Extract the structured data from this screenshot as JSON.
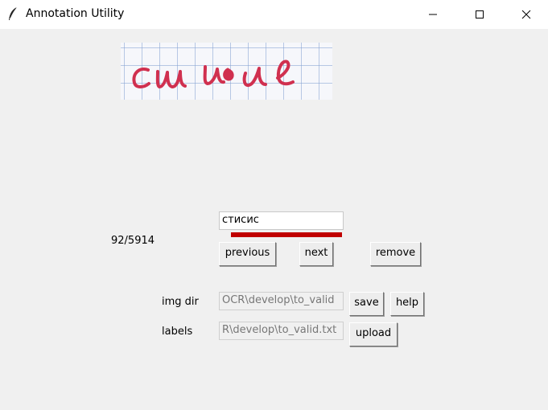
{
  "window": {
    "title": "Annotation Utility",
    "icon": "feather-icon",
    "controls": [
      "minimize-icon",
      "maximize-icon",
      "close-icon"
    ]
  },
  "preview": {
    "handwriting": "сиисис"
  },
  "annotation": {
    "counter": "92/5914",
    "text_value": "стисис",
    "progress_fraction": 1.0,
    "progress_color": "#c00000"
  },
  "buttons": {
    "previous": "previous",
    "next": "next",
    "remove": "remove",
    "save": "save",
    "help": "help",
    "upload": "upload"
  },
  "paths": {
    "img_dir_label": "img dir",
    "img_dir_value": "OCR\\develop\\to_valid",
    "labels_label": "labels",
    "labels_value": "R\\develop\\to_valid.txt"
  },
  "colors": {
    "window_bg": "#f0f0f0",
    "ink": "#d0304f",
    "accent_bar": "#c00000"
  }
}
